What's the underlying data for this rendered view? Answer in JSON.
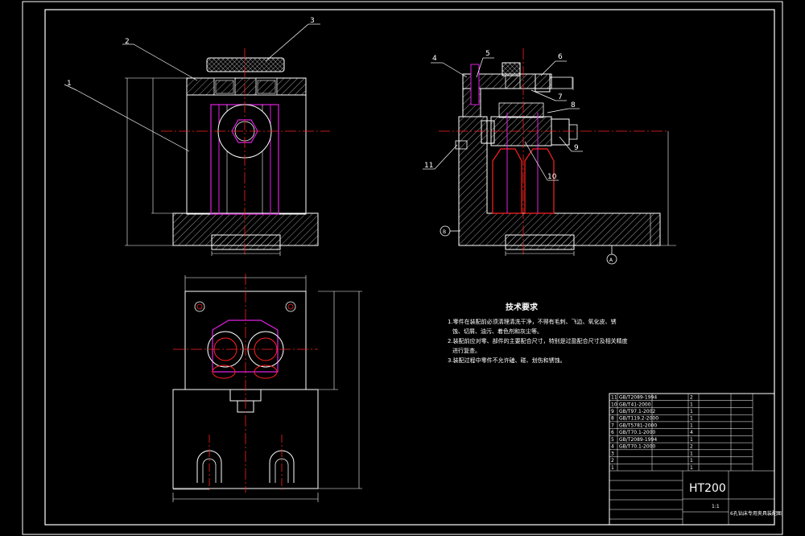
{
  "material": "HT200",
  "technical_requirements": {
    "title": "技术要求",
    "lines": [
      "1.零件在装配前必须清理清洗干净，不得有毛刺、飞边、氧化皮、锈",
      "蚀、切屑、油污、着色剂和灰尘等。",
      "2.装配前应对零、部件的主要配合尺寸，特别是过盈配合尺寸及相关精度",
      "进行复查。",
      "3.装配过程中零件不允许磕、碰、划伤和锈蚀。"
    ]
  },
  "part_balloons": [
    "1",
    "2",
    "3",
    "4",
    "5",
    "6",
    "7",
    "8",
    "9",
    "10",
    "11"
  ],
  "datum_labels": [
    "B",
    "A"
  ],
  "title_block": {
    "drawing_title": "6孔钻床专用夹具装配图",
    "scale": "1:1",
    "bom_rows": [
      {
        "no": "11",
        "code": "GB/T2089-1994",
        "qty": "2"
      },
      {
        "no": "10",
        "code": "GB/T41-2000",
        "qty": "1"
      },
      {
        "no": "9",
        "code": "GB/T97.1-2002",
        "qty": "1"
      },
      {
        "no": "8",
        "code": "GB/T119.2-2000",
        "qty": "1"
      },
      {
        "no": "7",
        "code": "GB/T5781-2000",
        "qty": "1"
      },
      {
        "no": "6",
        "code": "GB/T70.1-2000",
        "qty": "4"
      },
      {
        "no": "5",
        "code": "GB/T2089-1994",
        "qty": "1"
      },
      {
        "no": "4",
        "code": "GB/T70.1-2000",
        "qty": "2"
      },
      {
        "no": "3",
        "code": "",
        "qty": "1"
      },
      {
        "no": "2",
        "code": "",
        "qty": "1"
      },
      {
        "no": "1",
        "code": "",
        "qty": "1"
      }
    ]
  }
}
